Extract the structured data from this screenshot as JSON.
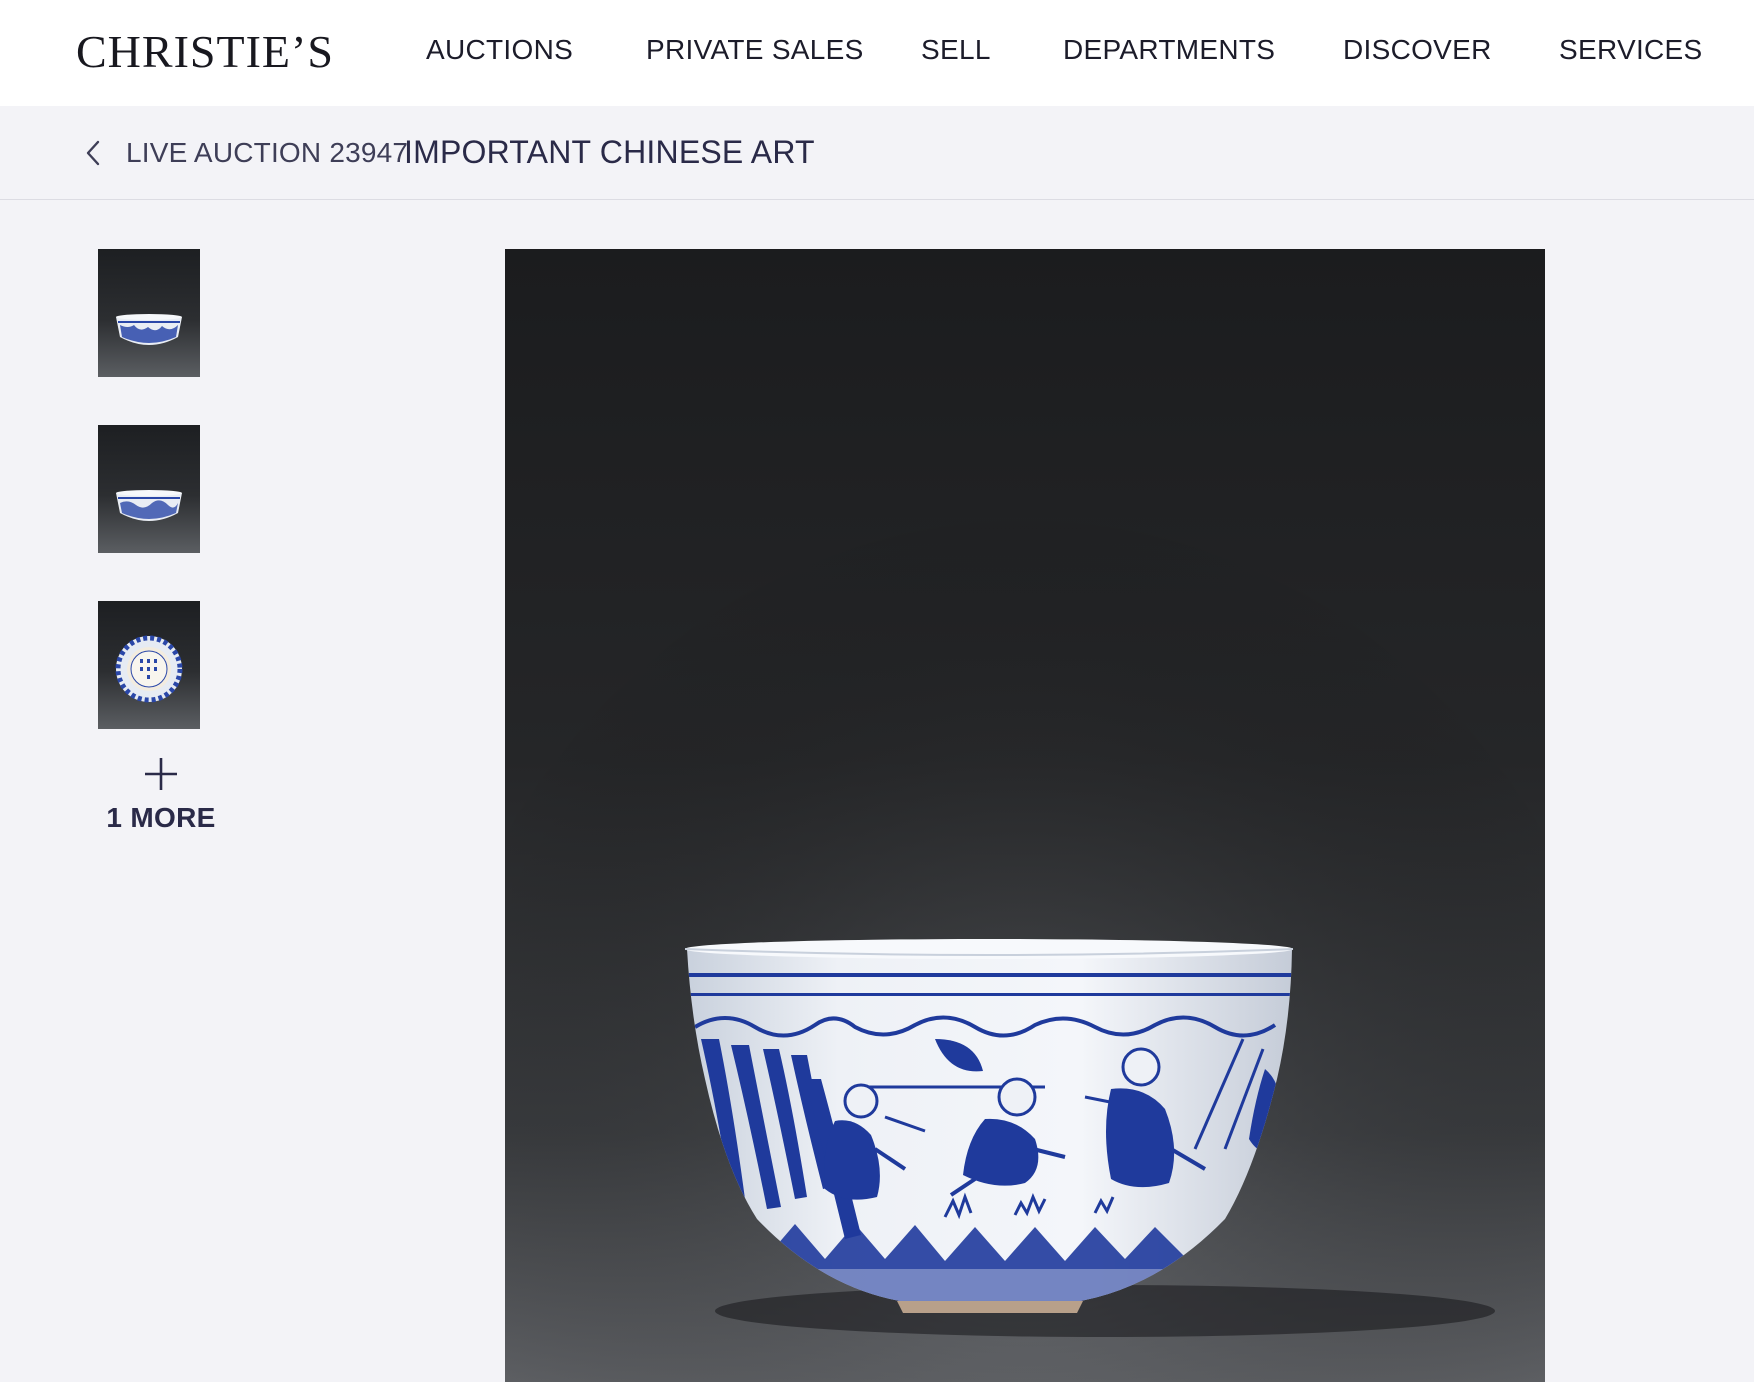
{
  "header": {
    "logo": "CHRISTIE’S",
    "nav": [
      "AUCTIONS",
      "PRIVATE SALES",
      "SELL",
      "DEPARTMENTS",
      "DISCOVER",
      "SERVICES"
    ]
  },
  "breadcrumb": {
    "auction_label": "LIVE AUCTION 23947",
    "sale_title": "IMPORTANT CHINESE ART"
  },
  "gallery": {
    "more_label": "1 MORE",
    "thumbnails": [
      {
        "icon": "bowl-side-view-image"
      },
      {
        "icon": "bowl-side-view-image"
      },
      {
        "icon": "bowl-base-mark-image"
      }
    ],
    "main_image": {
      "icon": "blue-and-white-bowl-image"
    }
  },
  "colors": {
    "nav_background": "#ffffff",
    "page_background": "#f3f3f7",
    "text_primary": "#1c1c2a",
    "accent_navy": "#2a2a48",
    "cobalt_blue": "#1f3a9c",
    "porcelain_white": "#eef1f6"
  }
}
